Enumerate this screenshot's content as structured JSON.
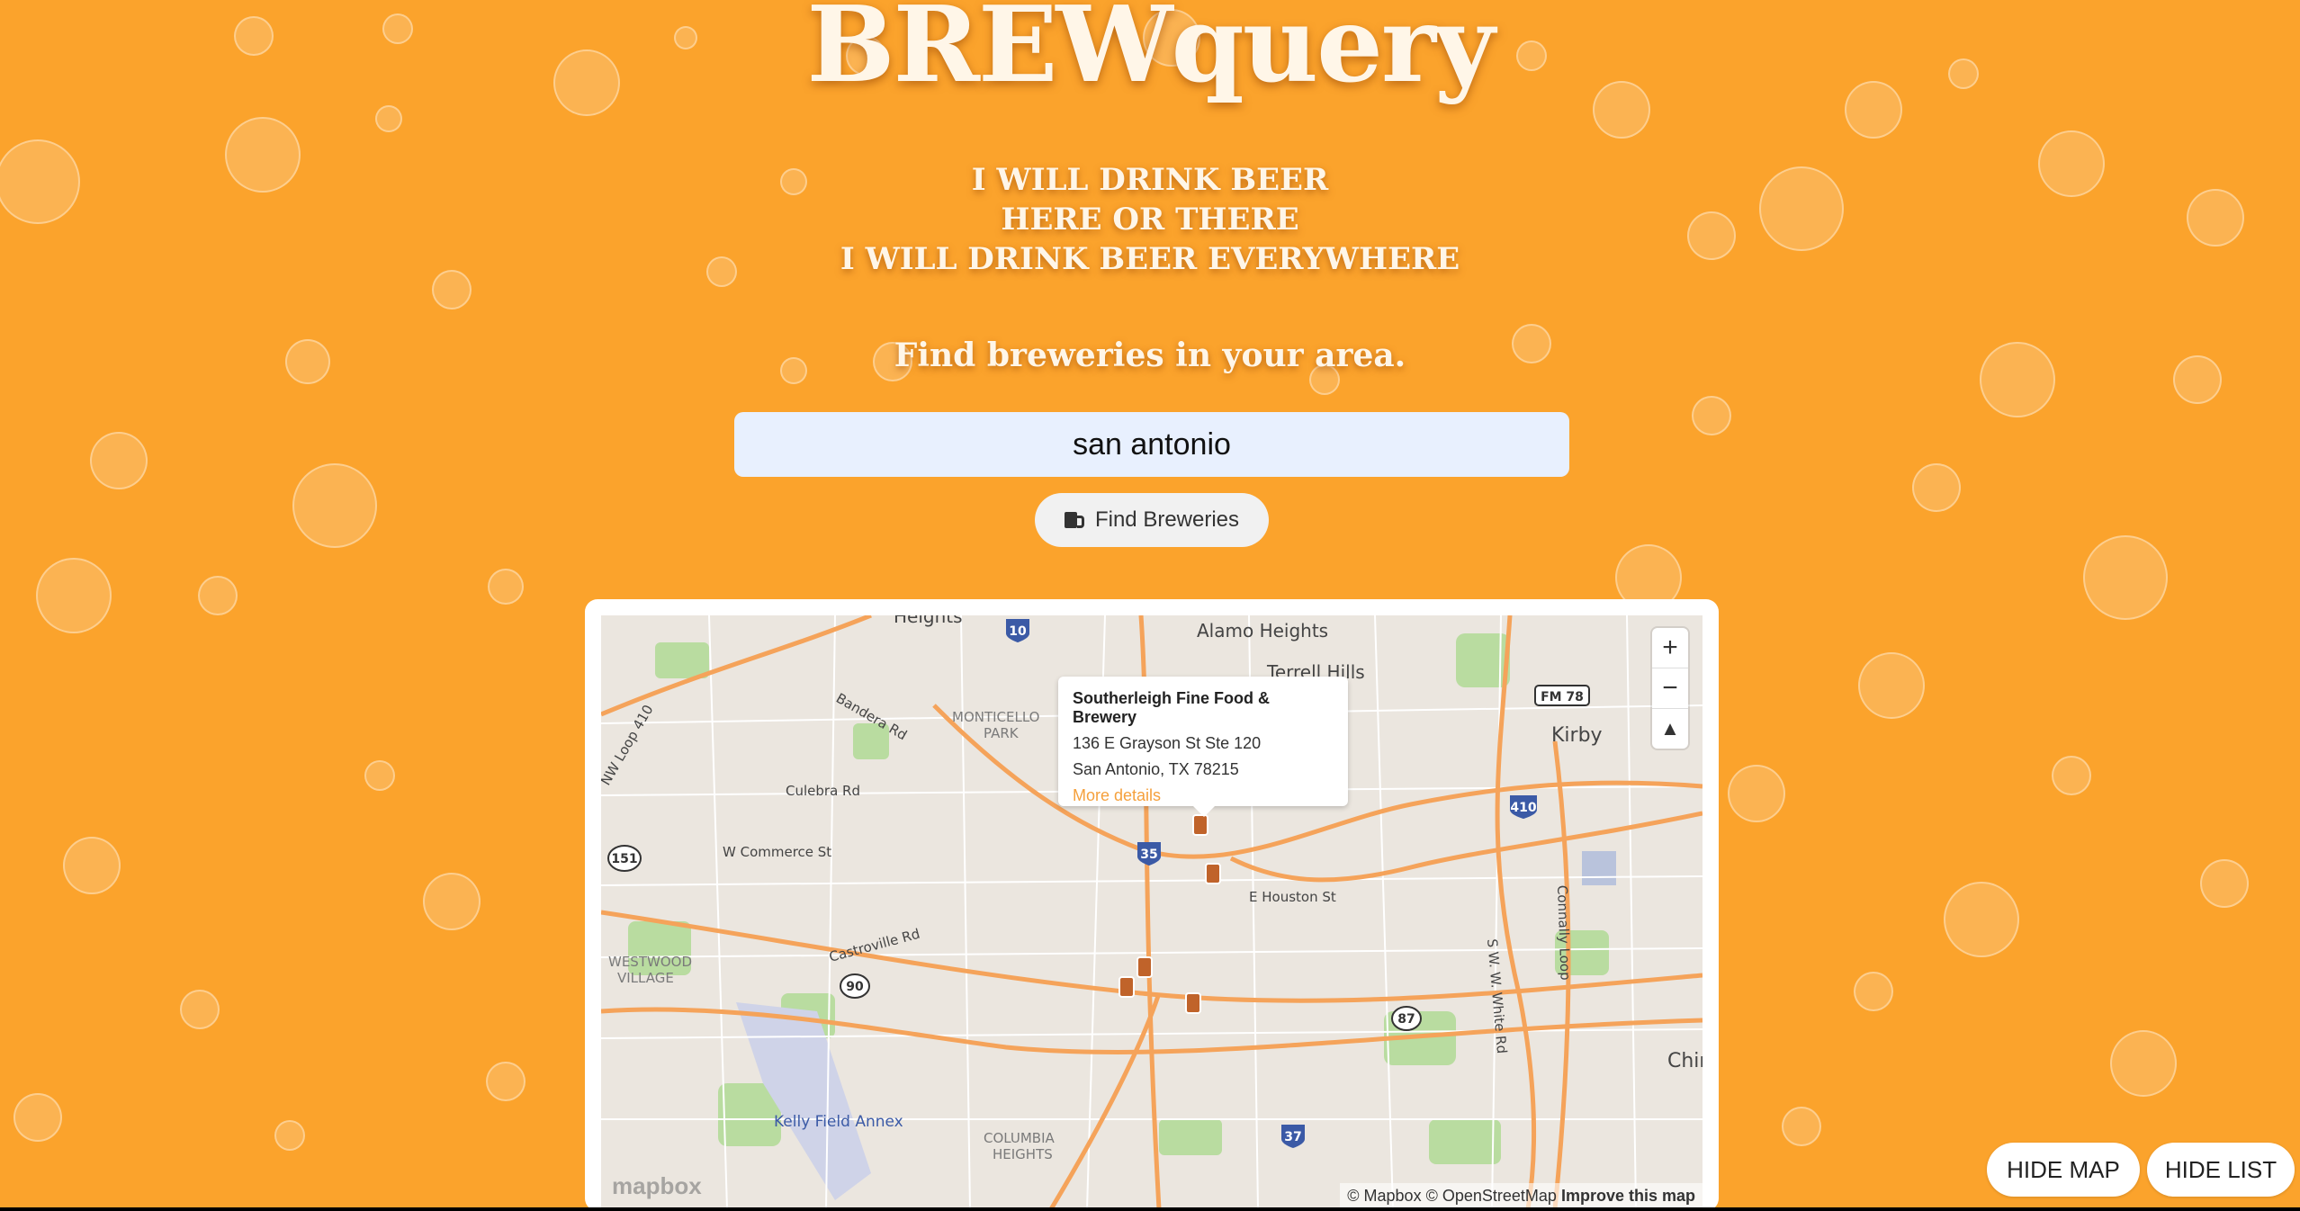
{
  "header": {
    "title": "BREWquery",
    "poem": [
      "I WILL DRINK BEER",
      "HERE OR THERE",
      "I WILL DRINK BEER EVERYWHERE"
    ],
    "tagline": "Find breweries in your area."
  },
  "search": {
    "value": "san antonio",
    "button_label": "Find Breweries",
    "button_icon": "beer-mug-icon"
  },
  "map": {
    "popup": {
      "name": "Southerleigh Fine Food & Brewery",
      "address1": "136 E Grayson St Ste 120",
      "address2": "San Antonio, TX 78215",
      "link": "More details"
    },
    "zoom_in": "+",
    "zoom_out": "−",
    "compass": "▲",
    "attribution": {
      "mapbox": "© Mapbox",
      "osm": "© OpenStreetMap",
      "improve": "Improve this map"
    },
    "logo": "mapbox",
    "place_labels": [
      "Heights",
      "Alamo Heights",
      "Terrell Hills",
      "Kirby",
      "MONTICELLO",
      "PARK",
      "Bandera Rd",
      "NW Loop 410",
      "Culebra Rd",
      "W Commerce St",
      "E Houston St",
      "Castroville Rd",
      "WESTWOOD",
      "VILLAGE",
      "Kelly Field Annex",
      "COLUMBIA",
      "HEIGHTS",
      "S W. W. White Rd",
      "Connally Loop",
      "Chin"
    ],
    "highway_shields": [
      "10",
      "35",
      "410",
      "151",
      "90",
      "37",
      "87",
      "FM 78"
    ]
  },
  "controls": {
    "hide_map": "HIDE MAP",
    "hide_list": "HIDE LIST"
  },
  "colors": {
    "background": "#fba32c",
    "marker": "#c0632a",
    "road": "#f5a35a",
    "link": "#f5a03c"
  }
}
